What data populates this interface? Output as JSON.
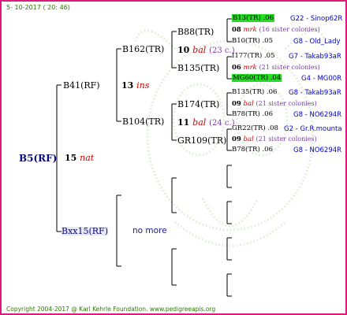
{
  "header": {
    "date": "5- 10-2017 ( 20: 46)"
  },
  "tree": {
    "root": {
      "name": "B5(RF)",
      "gen": "15",
      "suffix": "nat"
    },
    "father": {
      "name": "B41(RF)",
      "gen": "13",
      "suffix": "ins"
    },
    "mother": {
      "name": "Bxx15(RF)",
      "no_more": "no more"
    },
    "ff": {
      "name": "B162(TR)"
    },
    "fm": {
      "name": "B104(TR)"
    },
    "fff": {
      "name": "B88(TR)"
    },
    "fff_gen": {
      "num": "10",
      "suffix": "bal",
      "note": "(23 c.)"
    },
    "ffm": {
      "name": "B135(TR)"
    },
    "fmf": {
      "name": "B174(TR)"
    },
    "fmf_gen": {
      "num": "11",
      "suffix": "bal",
      "note": "(24 c.)"
    },
    "fmm": {
      "name": "GR109(TR)"
    },
    "g4": [
      {
        "name": "B13(TR) .06",
        "source": "G22 - Sinop62R",
        "highlight": true
      },
      {
        "num": "08",
        "suffix": "mrk",
        "note": "(16 sister colonies)"
      },
      {
        "name": "B10(TR) .05",
        "source": "G8 - Old_Lady"
      },
      {
        "name": "I177(TR) .05",
        "source": "G7 - Takab93aR"
      },
      {
        "num": "06",
        "suffix": "mrk",
        "note": "(21 sister colonies)"
      },
      {
        "name": "MG60(TR) .04",
        "source": "G4 - MG00R",
        "highlight": true
      },
      {
        "name": "B135(TR) .06",
        "source": "G8 - Takab93aR"
      },
      {
        "num": "09",
        "suffix": "bal",
        "note": "(21 sister colonies)"
      },
      {
        "name": "B78(TR) .06",
        "source": "G8 - NO6294R"
      },
      {
        "name": "GR22(TR) .08",
        "source": "G2 - Gr.R.mounta"
      },
      {
        "num": "09",
        "suffix": "bal",
        "note": "(21 sister colonies)"
      },
      {
        "name": "B78(TR) .06",
        "source": "G8 - NO6294R"
      }
    ]
  },
  "footer": {
    "copyright": "Copyright 2004-2017 @ Karl Kehrle Foundation.   www.pedigreeapis.org"
  },
  "colors": {
    "border": "#e0197d",
    "highlight": "#22dd22",
    "text_green": "#2a7a00",
    "source_blue": "#0000cc",
    "suffix_red": "#d40000"
  }
}
